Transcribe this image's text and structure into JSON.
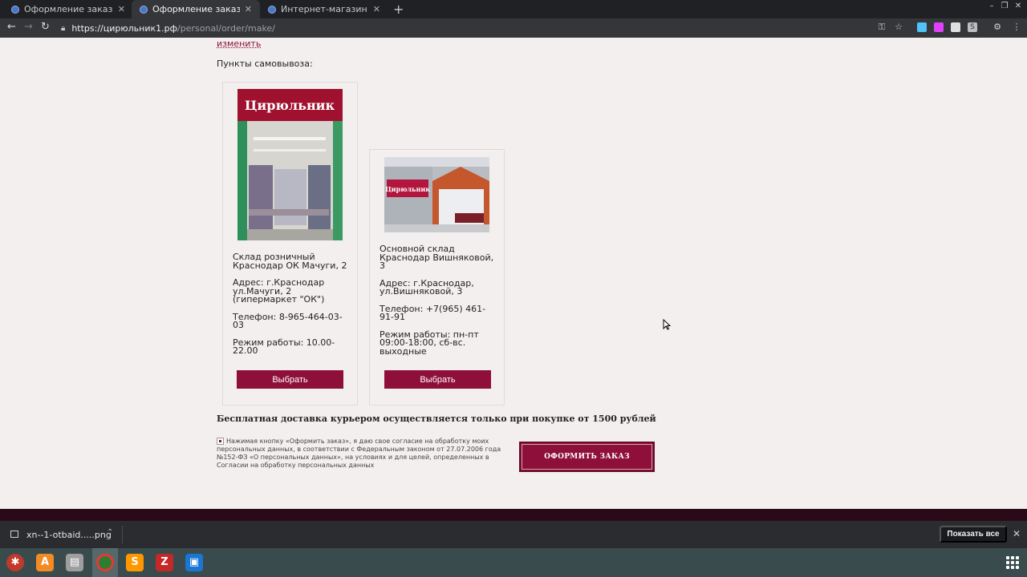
{
  "browser": {
    "tabs": [
      {
        "title": "Оформление заказа",
        "active": false
      },
      {
        "title": "Оформление заказа",
        "active": true
      },
      {
        "title": "Интернет-магазин \"Цир",
        "active": false
      }
    ],
    "url_host": "https://цирюльник1.рф",
    "url_path": "/personal/order/make/"
  },
  "page": {
    "change_link": "изменить",
    "pickup_title": "Пункты самовывоза:",
    "pickup_points": [
      {
        "photo_sign": "Цирюльник",
        "name": "Склад розничный Краснодар ОК Мачуги, 2",
        "address": "Адрес: г.Краснодар ул.Мачуги, 2 (гипермаркет \"ОК\")",
        "phone": "Телефон: 8-965-464-03-03",
        "hours": "Режим работы: 10.00-22.00",
        "button": "Выбрать"
      },
      {
        "photo_sign": "Цирюльник",
        "name": "Основной склад Краснодар Вишняковой, 3",
        "address": "Адрес: г.Краснодар, ул.Вишняковой, 3",
        "phone": "Телефон: +7(965) 461-91-91",
        "hours": "Режим работы: пн-пт 09:00-18:00, сб-вс. выходные",
        "button": "Выбрать"
      }
    ],
    "delivery_note": "Бесплатная доставка курьером осуществляется только при покупке от 1500 рублей",
    "consent_text": "Нажимая кнопку «Оформить заказ», я даю свое согласие на обработку моих персональных данных, в соответствии с Федеральным законом от 27.07.2006 года №152-ФЗ «О персональных данных», на условиях и для целей, определенных в Согласии на обработку персональных данных",
    "order_button": "ОФОРМИТЬ ЗАКАЗ"
  },
  "downloads": {
    "file_name": "xn--1-otbaid.....png",
    "show_all": "Показать все"
  },
  "colors": {
    "brand": "#8e0f3a",
    "page_bg": "#f4efef",
    "footer": "#2b0a17"
  }
}
